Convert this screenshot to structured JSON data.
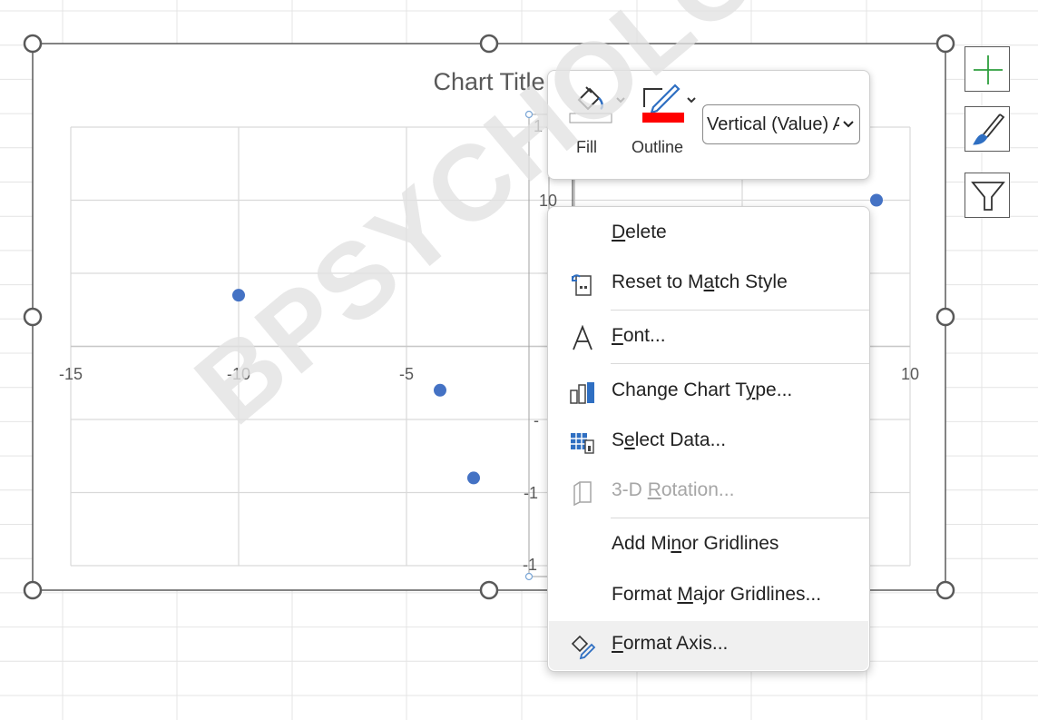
{
  "chart": {
    "title": "Chart Title",
    "x_tick_labels": [
      "-15",
      "-10",
      "-5",
      "10"
    ],
    "y_tick_labels": [
      "1",
      "10",
      "-",
      "-1",
      "-1"
    ]
  },
  "chart_data": {
    "type": "scatter",
    "title": "Chart Title",
    "xlim": [
      -15,
      10
    ],
    "x_ticks": [
      -15,
      -10,
      -5,
      0,
      5,
      10
    ],
    "ylim": [
      -15,
      15
    ],
    "y_ticks": [
      -15,
      -10,
      -5,
      0,
      5,
      10,
      15
    ],
    "grid": true,
    "series": [
      {
        "x": [
          -10,
          -4,
          -3,
          9
        ],
        "y": [
          3.5,
          -3,
          -9,
          10
        ]
      }
    ]
  },
  "toolbar": {
    "fill_label": "Fill",
    "outline_label": "Outline",
    "chart_element_select": "Vertical (Value) Axis",
    "outline_color": "#ff0000",
    "fill_color": "#ffffff"
  },
  "menu": {
    "items": [
      {
        "pre": "",
        "key": "D",
        "post": "elete",
        "icon": "none",
        "disabled": false
      },
      {
        "pre": "Reset to M",
        "key": "a",
        "post": "tch Style",
        "icon": "reset-style-icon",
        "disabled": false
      },
      {
        "pre": "",
        "key": "F",
        "post": "ont...",
        "icon": "font-icon",
        "disabled": false
      },
      {
        "pre": "Change Chart T",
        "key": "y",
        "post": "pe...",
        "icon": "change-chart-type-icon",
        "disabled": false
      },
      {
        "pre": "S",
        "key": "e",
        "post": "lect Data...",
        "icon": "select-data-icon",
        "disabled": false
      },
      {
        "pre": "3-D ",
        "key": "R",
        "post": "otation...",
        "icon": "3d-rotation-icon",
        "disabled": true
      },
      {
        "pre": "Add Mi",
        "key": "n",
        "post": "or Gridlines",
        "icon": "none",
        "disabled": false
      },
      {
        "pre": "Format ",
        "key": "M",
        "post": "ajor Gridlines...",
        "icon": "none",
        "disabled": false
      },
      {
        "pre": "",
        "key": "F",
        "post": "ormat Axis...",
        "icon": "format-axis-icon",
        "disabled": false
      }
    ]
  },
  "side_buttons": [
    "chart-elements-plus-icon",
    "chart-styles-brush-icon",
    "chart-filters-funnel-icon"
  ],
  "watermark": {
    "text": "BPSYCHOLOGY.COM"
  },
  "colors": {
    "marker": "#4472c4",
    "gridline": "#d9d9d9",
    "axis_label": "#595959",
    "selection_handle": "#595959"
  }
}
